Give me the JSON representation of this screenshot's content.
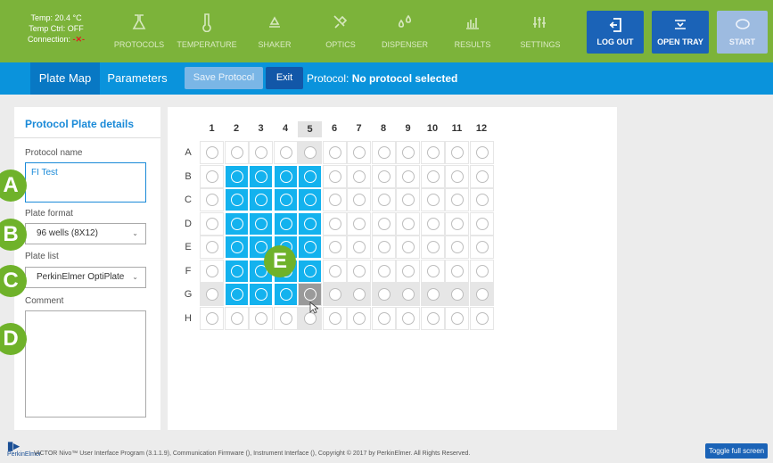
{
  "status": {
    "temp": "Temp: 20.4 °C",
    "temp_ctrl": "Temp Ctrl: OFF",
    "connection_label": "Connection:",
    "connection_icon": "disconnected-x-icon"
  },
  "toolbar": {
    "items": [
      {
        "label": "PROTOCOLS",
        "icon": "flask-icon"
      },
      {
        "label": "TEMPERATURE",
        "icon": "thermometer-icon"
      },
      {
        "label": "SHAKER",
        "icon": "shaker-icon"
      },
      {
        "label": "OPTICS",
        "icon": "satellite-icon"
      },
      {
        "label": "DISPENSER",
        "icon": "droplets-icon"
      },
      {
        "label": "RESULTS",
        "icon": "bar-chart-icon"
      },
      {
        "label": "SETTINGS",
        "icon": "sliders-icon"
      }
    ],
    "logout": "LOG OUT",
    "open_tray": "OPEN TRAY",
    "start": "START"
  },
  "nav": {
    "tabs": [
      "Plate Map",
      "Parameters"
    ],
    "active_tab": "Plate Map",
    "save_protocol": "Save Protocol",
    "exit": "Exit",
    "protocol_label": "Protocol:",
    "protocol_value": "No protocol selected"
  },
  "panel": {
    "title": "Protocol Plate details",
    "name_label": "Protocol name",
    "name_value": "FI Test",
    "format_label": "Plate format",
    "format_value": "96 wells (8X12)",
    "list_label": "Plate list",
    "list_value": "PerkinElmer OptiPlate",
    "comment_label": "Comment",
    "comment_value": ""
  },
  "plate": {
    "columns": [
      "1",
      "2",
      "3",
      "4",
      "5",
      "6",
      "7",
      "8",
      "9",
      "10",
      "11",
      "12"
    ],
    "rows": [
      "A",
      "B",
      "C",
      "D",
      "E",
      "F",
      "G",
      "H"
    ],
    "selected_rows": [
      "B",
      "C",
      "D",
      "E",
      "F",
      "G"
    ],
    "selected_cols": [
      "2",
      "3",
      "4",
      "5"
    ],
    "selected_exception": [
      "G5"
    ],
    "highlight_col": "5",
    "highlight_row": "G",
    "cursor_well": "G5"
  },
  "callouts": [
    "A",
    "B",
    "C",
    "D",
    "E"
  ],
  "footer": {
    "brand": "PerkinElmer",
    "copyright": "VICTOR Nivo™ User Interface Program (3.1.1.9), Communication Firmware (), Instrument Interface (), Copyright © 2017 by PerkinElmer. All Rights Reserved.",
    "toggle_fullscreen": "Toggle full screen"
  },
  "colors": {
    "toolbar_green": "#7cb33a",
    "nav_blue": "#0a93dc",
    "selected_well": "#13b2ee",
    "button_blue": "#1b63b7",
    "callout_green": "#6fb22a"
  }
}
